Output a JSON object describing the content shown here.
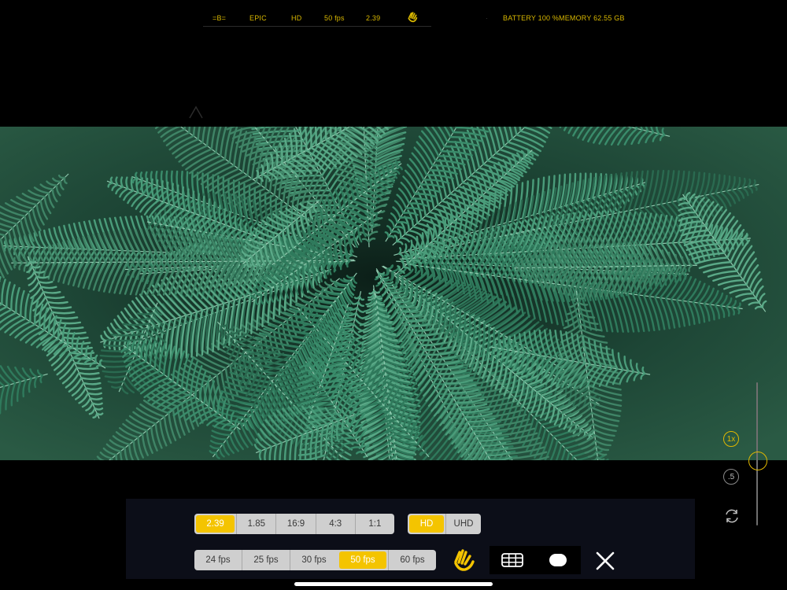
{
  "status_bar": {
    "logo": "=B=",
    "camera": "EPIC",
    "resolution": "HD",
    "framerate": "50 fps",
    "aspect": "2.39",
    "battery": "BATTERY 100 %",
    "memory": "MEMORY  62.55 GB",
    "hand_icon": "hand-icon"
  },
  "aspect_ratios": {
    "options": [
      "2.39",
      "1.85",
      "16:9",
      "4:3",
      "1:1"
    ],
    "selected": "2.39"
  },
  "resolutions": {
    "options": [
      "HD",
      "UHD"
    ],
    "selected": "HD"
  },
  "framerates": {
    "options": [
      "24 fps",
      "25 fps",
      "30 fps",
      "50 fps",
      "60 fps"
    ],
    "selected": "50 fps"
  },
  "tools": {
    "stabilization_icon": "hand-icon",
    "grid_icon": "grid-icon",
    "record_icon": "record-pill-icon",
    "close_icon": "close-icon"
  },
  "zoom": {
    "options": [
      "1x",
      ".5"
    ],
    "selected": "1x",
    "flip_icon": "flip-camera-icon"
  },
  "colors": {
    "accent": "#f4c400",
    "status_text": "#d9b800",
    "panel_bg": "#0c0e18"
  }
}
